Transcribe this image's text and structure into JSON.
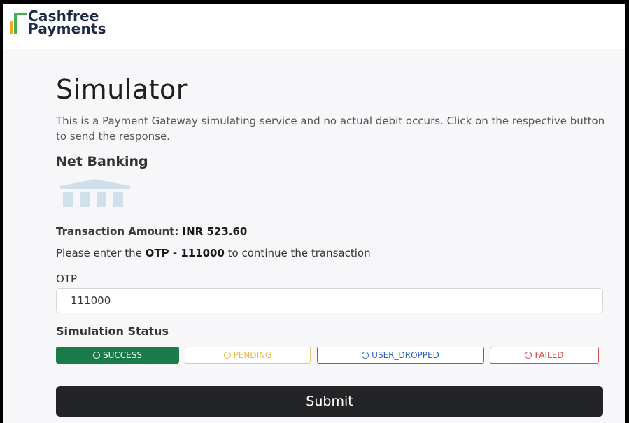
{
  "brand": {
    "line1": "Cashfree",
    "line2": "Payments",
    "color_text": "#1f2a44",
    "color_green": "#3fb349",
    "color_orange": "#f5a623"
  },
  "page": {
    "title": "Simulator",
    "description": "This is a Payment Gateway simulating service and no actual debit occurs. Click on the respective button to send the response."
  },
  "method": {
    "heading": "Net Banking",
    "icon": "bank-icon"
  },
  "transaction": {
    "amount_label": "Transaction Amount: ",
    "amount_value": "INR 523.60"
  },
  "otp": {
    "instruction_prefix": "Please enter the ",
    "instruction_code": "OTP - 111000",
    "instruction_suffix": " to continue the transaction",
    "label": "OTP",
    "value": "111000"
  },
  "simulation": {
    "heading": "Simulation Status",
    "options": [
      {
        "label": "SUCCESS",
        "selected": true,
        "color": "#1a7a4a"
      },
      {
        "label": "PENDING",
        "selected": false,
        "color": "#f0c76a"
      },
      {
        "label": "USER_DROPPED",
        "selected": false,
        "color": "#3b6fd0"
      },
      {
        "label": "FAILED",
        "selected": false,
        "color": "#d05050"
      }
    ]
  },
  "submit_label": "Submit"
}
